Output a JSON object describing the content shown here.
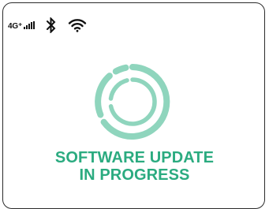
{
  "status_bar": {
    "network_label": "4G⁺",
    "signal_icon": "signal-bars-icon",
    "bluetooth_icon": "bluetooth-icon",
    "wifi_icon": "wifi-icon"
  },
  "update": {
    "icon": "progress-ring-icon",
    "line1": "SOFTWARE UPDATE",
    "line2": "IN PROGRESS"
  },
  "colors": {
    "accent_text": "#2bab80",
    "ring_outer": "#8fd5bd",
    "ring_inner": "#8fd5bd",
    "frame": "#2b2b2b"
  }
}
